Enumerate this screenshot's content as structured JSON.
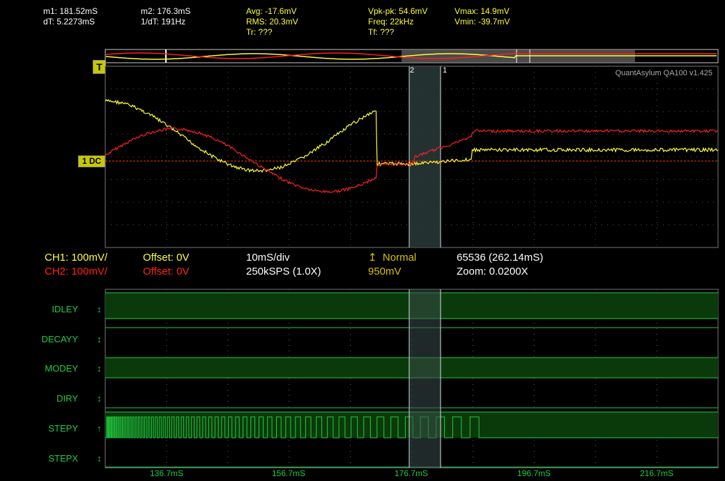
{
  "measurements": {
    "m1": "m1: 181.52mS",
    "dT": "dT: 5.2273mS",
    "m2": "m2: 176.3mS",
    "inv_dT": "1/dT: 191Hz",
    "avg": "Avg: -17.6mV",
    "rms": "RMS: 20.3mV",
    "tr": "Tr: ???",
    "vpkpk": "Vpk-pk: 54.6mV",
    "freq": "Freq: 22kHz",
    "tf": "Tf: ???",
    "vmax": "Vmax: 14.9mV",
    "vmin": "Vmin: -39.7mV"
  },
  "trigger_marker": "T",
  "level_marker": "1 DC",
  "cursor_labels": {
    "c2": "2",
    "c1": "1"
  },
  "watermark": "QuantAsylum QA100 v1.425",
  "settings": {
    "ch1_scale": "CH1: 100mV/",
    "ch1_offset": "Offset: 0V",
    "ch2_scale": "CH2: 100mV/",
    "ch2_offset": "Offset: 0V",
    "timebase": "10mS/div",
    "samplerate": "250kSPS (1.0X)",
    "trigger_mode": "Normal",
    "trigger_level": "950mV",
    "samples": "65536 (262.14mS)",
    "zoom": "Zoom: 0.0200X"
  },
  "digital_channels": [
    {
      "name": "IDLEY",
      "arrow": "↕",
      "state": "high"
    },
    {
      "name": "DECAYY",
      "arrow": "↕",
      "state": "low"
    },
    {
      "name": "MODEY",
      "arrow": "↕",
      "state": "high"
    },
    {
      "name": "DIRY",
      "arrow": "↕",
      "state": "low"
    },
    {
      "name": "STEPY",
      "arrow": "↑",
      "state": "pulses"
    },
    {
      "name": "STEPX",
      "arrow": "↕",
      "state": "low"
    }
  ],
  "time_axis": [
    "136.7mS",
    "156.7mS",
    "176.7mS",
    "196.7mS",
    "216.7mS"
  ],
  "colors": {
    "ch1": "#ffff33",
    "ch2": "#ff2020",
    "digital": "#22cc44",
    "digital_fill": "#0a3a0a",
    "grid": "#555555",
    "cursor_region": "#2a3a3a"
  }
}
